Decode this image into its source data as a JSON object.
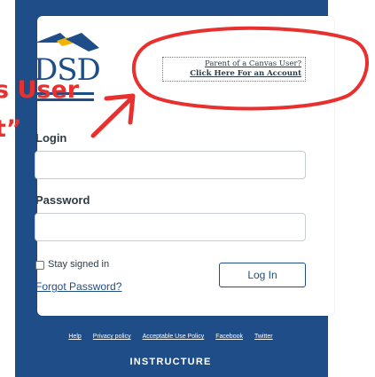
{
  "annotation": {
    "lines": [
      "s User",
      "t”"
    ],
    "arrow_color": "#e8312f",
    "circle_color": "#e8312f"
  },
  "branding": {
    "logo_text": "DSD",
    "logo_colors": {
      "blue": "#1f4d87",
      "gold": "#f2b300"
    },
    "footer_brand": "INSTRUCTURE"
  },
  "header": {
    "parent_link_line1": "Parent of a Canvas User?",
    "parent_link_line2": "Click Here For an Account"
  },
  "form": {
    "login_label": "Login",
    "password_label": "Password",
    "login_value": "",
    "password_value": "",
    "stay_signed_in": "Stay signed in",
    "forgot_password": "Forgot Password?",
    "login_button": "Log In"
  },
  "footer": {
    "links": [
      "Help",
      "Privacy policy",
      "Acceptable Use Policy",
      "Facebook",
      "Twitter"
    ]
  },
  "colors": {
    "frame_background": "#1f4d87",
    "card_background": "#ffffff",
    "text": "#2d3b45"
  }
}
